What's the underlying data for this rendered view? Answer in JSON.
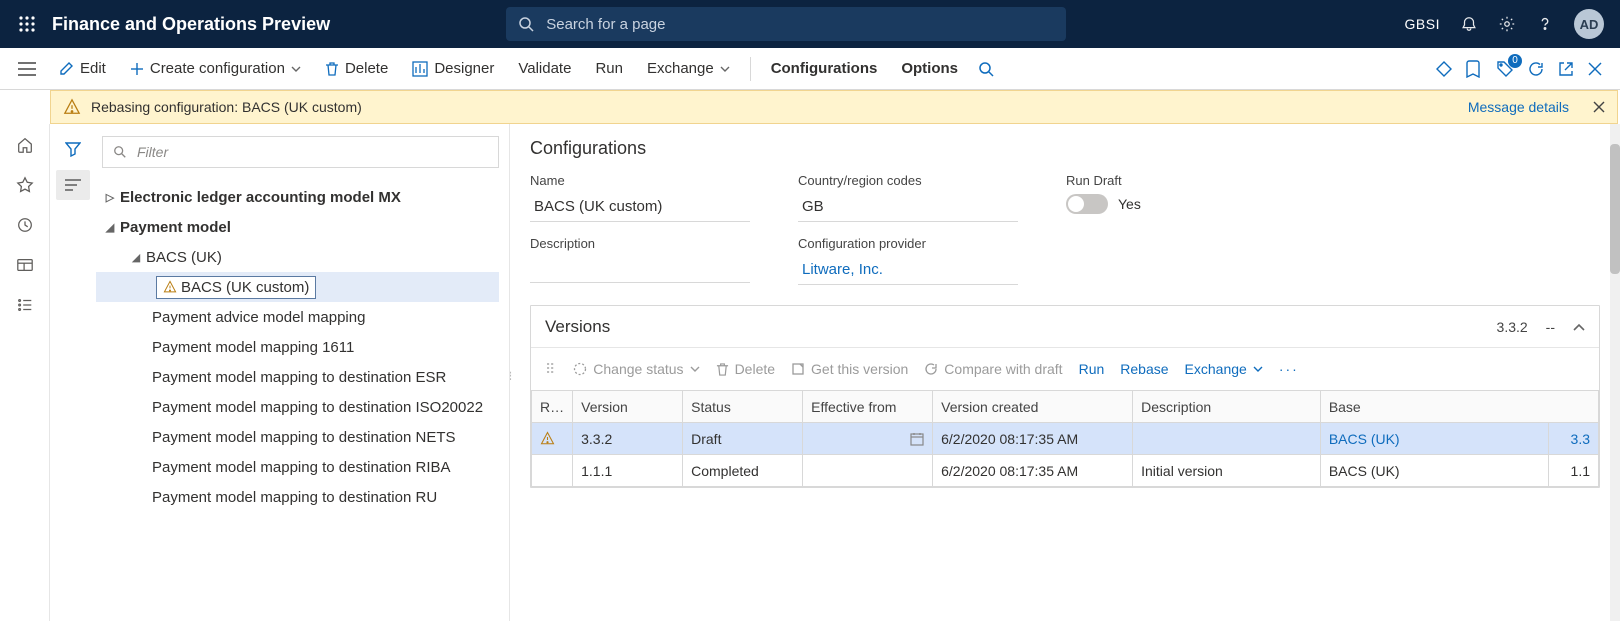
{
  "header": {
    "brand": "Finance and Operations Preview",
    "search_placeholder": "Search for a page",
    "org": "GBSI",
    "avatar": "AD"
  },
  "actions": {
    "edit": "Edit",
    "create": "Create configuration",
    "delete": "Delete",
    "designer": "Designer",
    "validate": "Validate",
    "run": "Run",
    "exchange": "Exchange",
    "configurations": "Configurations",
    "options": "Options",
    "badge_count": "0"
  },
  "banner": {
    "text": "Rebasing configuration: BACS (UK custom)",
    "details": "Message details"
  },
  "filter_placeholder": "Filter",
  "tree": {
    "n0": "Electronic ledger accounting model MX",
    "n1": "Payment model",
    "n2": "BACS (UK)",
    "n3": "BACS (UK custom)",
    "n4": "Payment advice model mapping",
    "n5": "Payment model mapping 1611",
    "n6": "Payment model mapping to destination ESR",
    "n7": "Payment model mapping to destination ISO20022",
    "n8": "Payment model mapping to destination NETS",
    "n9": "Payment model mapping to destination RIBA",
    "n10": "Payment model mapping to destination RU"
  },
  "detail": {
    "title": "Configurations",
    "name_label": "Name",
    "name_value": "BACS (UK custom)",
    "country_label": "Country/region codes",
    "country_value": "GB",
    "run_label": "Run Draft",
    "run_value": "Yes",
    "desc_label": "Description",
    "provider_label": "Configuration provider",
    "provider_value": "Litware, Inc."
  },
  "versions": {
    "title": "Versions",
    "current": "3.3.2",
    "dashes": "--",
    "tools": {
      "change": "Change status",
      "delete": "Delete",
      "get": "Get this version",
      "compare": "Compare with draft",
      "run": "Run",
      "rebase": "Rebase",
      "exchange": "Exchange"
    },
    "cols": {
      "r": "R…",
      "version": "Version",
      "status": "Status",
      "effective": "Effective from",
      "created": "Version created",
      "desc": "Description",
      "base": "Base"
    },
    "rows": [
      {
        "warn": true,
        "version": "3.3.2",
        "status": "Draft",
        "effective": "",
        "created": "6/2/2020 08:17:35 AM",
        "desc": "",
        "base": "BACS (UK)",
        "base_v": "3.3"
      },
      {
        "warn": false,
        "version": "1.1.1",
        "status": "Completed",
        "effective": "",
        "created": "6/2/2020 08:17:35 AM",
        "desc": "Initial version",
        "base": "BACS (UK)",
        "base_v": "1.1"
      }
    ]
  }
}
